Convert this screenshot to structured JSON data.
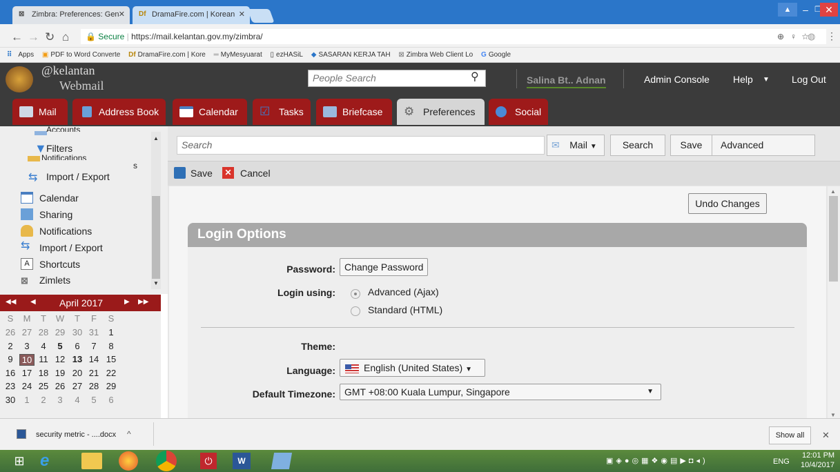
{
  "browser": {
    "tabs": [
      {
        "favicon": "zimbra-icon",
        "title": "Zimbra: Preferences: Gen"
      },
      {
        "favicon": "Df",
        "title": "DramaFire.com | Korean"
      }
    ],
    "secure_label": "Secure",
    "url": "https://mail.kelantan.gov.my/zimbra/",
    "bookmarks": [
      "Apps",
      "PDF to Word Converte",
      "DramaFire.com | Kore",
      "MyMesyuarat",
      "ezHASiL",
      "SASARAN KERJA TAH",
      "Zimbra Web Client Lo",
      "Google"
    ]
  },
  "header": {
    "brand_line1": "@kelantan",
    "brand_line2": "Webmail",
    "people_search_placeholder": "People Search",
    "user_name": "Salina Bt.. Adnan",
    "admin_console": "Admin Console",
    "help": "Help",
    "logout": "Log Out"
  },
  "app_tabs": [
    {
      "label": "Mail",
      "color": "#9e1a1a"
    },
    {
      "label": "Address Book",
      "color": "#9e1a1a"
    },
    {
      "label": "Calendar",
      "color": "#9e1a1a"
    },
    {
      "label": "Tasks",
      "color": "#9e1a1a"
    },
    {
      "label": "Briefcase",
      "color": "#9e1a1a"
    },
    {
      "label": "Preferences",
      "color": "#d6d6d6"
    },
    {
      "label": "Social",
      "color": "#9e1a1a"
    }
  ],
  "left_nav": {
    "overlay_items": [
      "Accounts",
      "Filters",
      "Notifications",
      "Import / Export"
    ],
    "overlay_fragment": "s",
    "items": [
      "Calendar",
      "Sharing",
      "Notifications",
      "Import / Export",
      "Shortcuts",
      "Zimlets"
    ]
  },
  "mini_calendar": {
    "month": "April 2017",
    "dow": [
      "S",
      "M",
      "T",
      "W",
      "T",
      "F",
      "S"
    ],
    "weeks": [
      [
        "26",
        "27",
        "28",
        "29",
        "30",
        "31",
        "1"
      ],
      [
        "2",
        "3",
        "4",
        "5",
        "6",
        "7",
        "8"
      ],
      [
        "9",
        "10",
        "11",
        "12",
        "13",
        "14",
        "15"
      ],
      [
        "16",
        "17",
        "18",
        "19",
        "20",
        "21",
        "22"
      ],
      [
        "23",
        "24",
        "25",
        "26",
        "27",
        "28",
        "29"
      ],
      [
        "30",
        "1",
        "2",
        "3",
        "4",
        "5",
        "6"
      ]
    ]
  },
  "search": {
    "placeholder": "Search",
    "mail_type": "Mail",
    "search_btn": "Search",
    "save_btn": "Save",
    "advanced_btn": "Advanced"
  },
  "toolbar": {
    "save": "Save",
    "cancel": "Cancel"
  },
  "prefs": {
    "undo": "Undo Changes",
    "section_title": "Login Options",
    "password_label": "Password:",
    "change_password": "Change Password",
    "login_using_label": "Login using:",
    "login_options": [
      "Advanced (Ajax)",
      "Standard (HTML)"
    ],
    "theme_label": "Theme:",
    "language_label": "Language:",
    "language_value": "English (United States)",
    "timezone_label": "Default Timezone:",
    "timezone_value": "GMT +08:00 Kuala Lumpur, Singapore"
  },
  "downloads": {
    "file": "security metric - ....docx",
    "show_all": "Show all"
  },
  "taskbar": {
    "lang": "ENG",
    "time": "12:01 PM",
    "date": "10/4/2017"
  }
}
